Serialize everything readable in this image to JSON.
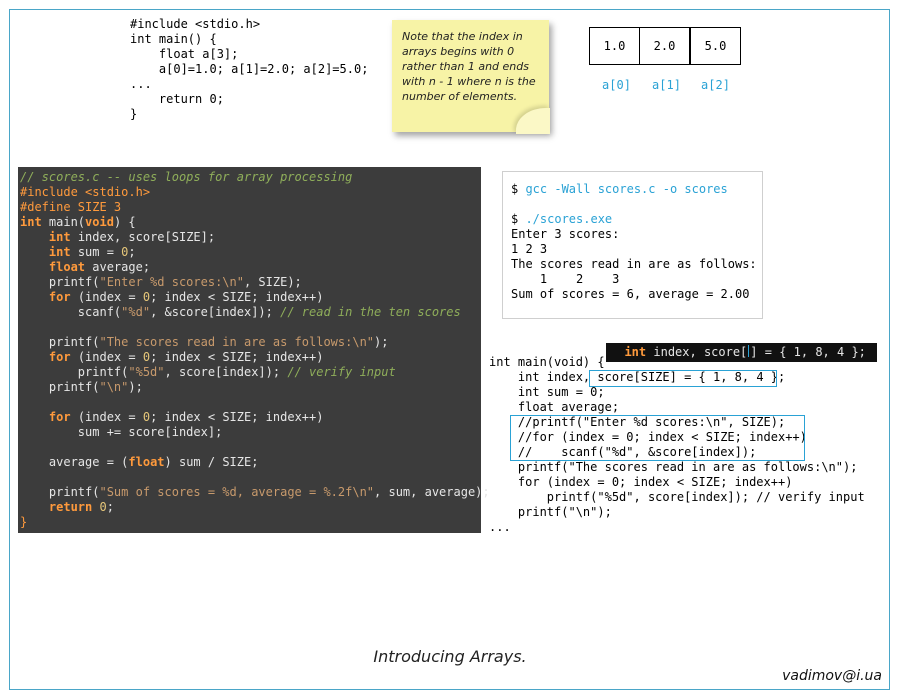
{
  "top_code": {
    "l1": "#include <stdio.h>",
    "l2": "int main() {",
    "l3": "    float a[3];",
    "l4": "    a[0]=1.0; a[1]=2.0; a[2]=5.0;",
    "l5": "...",
    "l6": "    return 0;",
    "l7": "}"
  },
  "note": {
    "text": "Note that the index in arrays begins with 0 rather than 1 and ends with n - 1 where n is the number of elements."
  },
  "array": {
    "values": [
      "1.0",
      "2.0",
      "5.0"
    ],
    "labels": [
      "a[0]",
      "a[1]",
      "a[2]"
    ]
  },
  "dark_code": {
    "l1": "// scores.c -- uses loops for array processing",
    "l2": "#include <stdio.h>",
    "l3": "#define SIZE 3",
    "l4a": "int",
    "l4b": " main(",
    "l4c": "void",
    "l4d": ") {",
    "l5a": "int",
    "l5b": " index, score[SIZE];",
    "l6a": "int",
    "l6b": " sum = ",
    "l6c": "0",
    "l6d": ";",
    "l7a": "float",
    "l7b": " average;",
    "l8a": "printf(",
    "l8b": "\"Enter %d scores:\\n\"",
    "l8c": ", SIZE);",
    "l9a": "for",
    "l9b": " (index = ",
    "l9c": "0",
    "l9d": "; index < SIZE; index++)",
    "l10a": "scanf(",
    "l10b": "\"%d\"",
    "l10c": ", &score[index]); ",
    "l10d": "// read in the ten scores",
    "l11a": "printf(",
    "l11b": "\"The scores read in are as follows:\\n\"",
    "l11c": ");",
    "l12a": "for",
    "l12b": " (index = ",
    "l12c": "0",
    "l12d": "; index < SIZE; index++)",
    "l13a": "printf(",
    "l13b": "\"%5d\"",
    "l13c": ", score[index]); ",
    "l13d": "// verify input",
    "l14a": "printf(",
    "l14b": "\"\\n\"",
    "l14c": ");",
    "l15a": "for",
    "l15b": " (index = ",
    "l15c": "0",
    "l15d": "; index < SIZE; index++)",
    "l16": "sum += score[index];",
    "l17a": "average = (",
    "l17b": "float",
    "l17c": ") sum / SIZE;",
    "l18a": "printf(",
    "l18b": "\"Sum of scores = %d, average = %.2f\\n\"",
    "l18c": ", sum, average);",
    "l19a": "return",
    "l19b": " 0",
    "l19c": ";",
    "l20": "}"
  },
  "terminal": {
    "p1": "$ ",
    "c1": "gcc -Wall scores.c -o scores",
    "p2": "$ ",
    "c2": "./scores.exe",
    "o1": "Enter 3 scores:",
    "o2": "1 2 3",
    "o3": "The scores read in are as follows:",
    "o4": "    1    2    3",
    "o5": "Sum of scores = 6, average = 2.00"
  },
  "snippet": {
    "kw": "int",
    "a": " index, score[",
    "b": "] = { 1, 8, 4 };"
  },
  "br_code": {
    "l1": "int main(void) {",
    "l2a": "    int index, ",
    "l2b": "score[SIZE] = { 1, 8, 4 };",
    "l3": "    int sum = 0;",
    "l4": "    float average;",
    "l5": "    //printf(\"Enter %d scores:\\n\", SIZE);",
    "l6": "    //for (index = 0; index < SIZE; index++)",
    "l7": "    //    scanf(\"%d\", &score[index]);",
    "l8": "    printf(\"The scores read in are as follows:\\n\");",
    "l9": "    for (index = 0; index < SIZE; index++)",
    "l10": "        printf(\"%5d\", score[index]); // verify input",
    "l11": "    printf(\"\\n\");",
    "l12": "..."
  },
  "caption": "Introducing Arrays.",
  "email": "vadimov@i.ua"
}
